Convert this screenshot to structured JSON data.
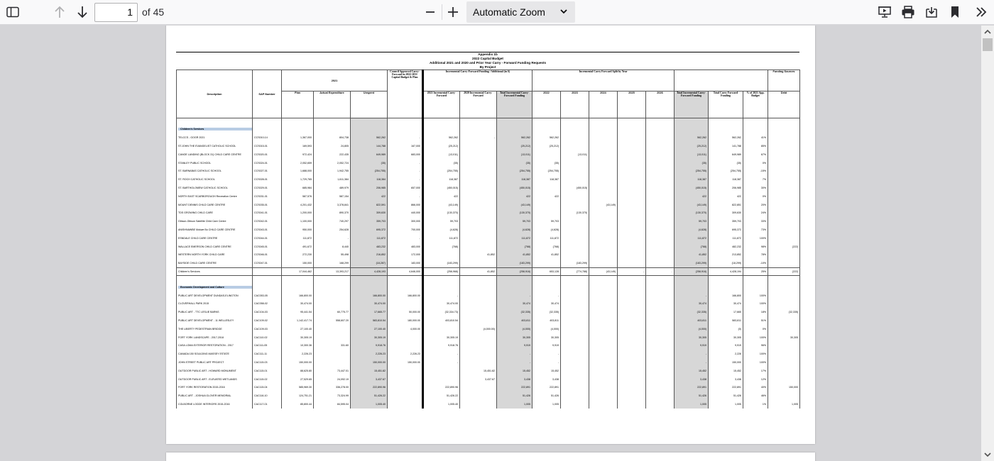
{
  "toolbar": {
    "page_number": "1",
    "page_of": "of 45",
    "zoom_value": "Automatic Zoom"
  },
  "document": {
    "title_lines": [
      "Appendix 1b",
      "2022 Capital Budget",
      "Additional 2021 and 2020 and Prior Year Carry - Forward Funding Requests",
      "By Project"
    ],
    "headers": {
      "description": "Description",
      "sap": "SAP Number",
      "year2021": "2021",
      "plan": "Plan",
      "actual": "Actual Expenditure",
      "unspent": "Unspent",
      "council": "Council Approved Carry-Forward in 2022-2031 Capital Budget & Plan",
      "incremental": "Incremental Carry-Forward Funding / Additional (in $)",
      "inc2021": "2021 Incremental Carry-Forward",
      "inc2020": "2020 Incremental Carry-Forward",
      "total_inc": "Total Incremental Carry-Forward Funding",
      "split": "Incremental Carry Forward Split by Year",
      "y2022": "2022",
      "y2023": "2023",
      "y2024": "2024",
      "y2025": "2025",
      "y2026": "2026",
      "total_inc2": "Total Incremental Carry-Forward Funding",
      "total_carry": "Total Carry Forward Funding",
      "pct": "% of 2021 App. Budget",
      "funding": "Funding Sources",
      "debt": "Debt"
    },
    "sections": [
      {
        "name": "Children's Services",
        "rows": [
          [
            "TELCCS - GOGR 2021",
            "CCS010-14",
            "1,367,000",
            "804,738",
            "562,262",
            "-",
            "562,262",
            "-",
            "562,262",
            "562,262",
            "",
            "",
            "",
            "",
            "562,262",
            "562,262",
            "41%",
            ""
          ],
          [
            "ST.JOHN THE EVANGELIST CATHOLIC SCHOOL",
            "CCS015-01",
            "169,593",
            "24,805",
            "144,788",
            "167,000",
            "(25,212)",
            "",
            "(25,212)",
            "(25,212)",
            "",
            "",
            "",
            "",
            "(25,212)",
            "141,788",
            "85%",
            ""
          ],
          [
            "CANOE LANDING (BLOCK 31) CHILD CARE CENTRE",
            "CCS020-01",
            "972,424",
            "222,435",
            "649,989",
            "683,000",
            "(13,011)",
            "",
            "(13,011)",
            "",
            "(13,011)",
            "",
            "",
            "",
            "(13,011)",
            "649,989",
            "67%",
            ""
          ],
          [
            "STANLEY PUBLIC SCHOOL",
            "CCS024-01",
            "2,052,659",
            "2,052,724",
            "(35)",
            "-",
            "(35)",
            "",
            "(35)",
            "(35)",
            "",
            "",
            "",
            "",
            "(35)",
            "(35)",
            "0%",
            ""
          ],
          [
            "ST. BARNABAS CATHOLIC SCHOOL",
            "CCS027-01",
            "1,688,000",
            "1,942,755",
            "(254,755)",
            "-",
            "(254,755)",
            "",
            "(254,755)",
            "(254,755)",
            "",
            "",
            "",
            "",
            "(254,755)",
            "(254,755)",
            "-15%",
            ""
          ],
          [
            "ST. ROCH CATHOLIC SCHOOL",
            "CCS028-01",
            "1,729,765",
            "1,611,384",
            "118,384",
            "-",
            "118,387",
            "",
            "118,387",
            "118,387",
            "",
            "",
            "",
            "",
            "118,387",
            "118,387",
            "7%",
            ""
          ],
          [
            "ST. BARTHOLOMEW CATHOLIC SCHOOL",
            "CCS029-01",
            "685,984",
            "489,979",
            "206,985",
            "657,000",
            "(450,015)",
            "",
            "(450,015)",
            "",
            "(450,015)",
            "",
            "",
            "",
            "(450,015)",
            "206,985",
            "30%",
            ""
          ],
          [
            "NORTH EAST SCARBOROUGH Recreation Centre",
            "CCS031-01",
            "587,576",
            "587,154",
            "422",
            "-",
            "422",
            "",
            "422",
            "422",
            "",
            "",
            "",
            "",
            "422",
            "422",
            "0%",
            ""
          ],
          [
            "MOUNT DENNIS CHILD CARE CENTRE",
            "CCS035-01",
            "4,201,432",
            "3,378,841",
            "822,591",
            "866,000",
            "(43,149)",
            "",
            "(43,149)",
            "",
            "",
            "(43,149)",
            "",
            "",
            "(43,149)",
            "822,851",
            "20%",
            ""
          ],
          [
            "TDS GROWING CHILD CARE",
            "CCS041-01",
            "1,200,000",
            "890,370",
            "309,630",
            "440,000",
            "(130,370)",
            "",
            "(130,370)",
            "",
            "(130,370)",
            "",
            "",
            "",
            "(130,370)",
            "309,630",
            "24%",
            ""
          ],
          [
            "Gibson-Gibson Satellite Child Care Centre",
            "CCS042-01",
            "1,100,000",
            "740,297",
            "359,703",
            "300,000",
            "59,703",
            "",
            "59,703",
            "59,703",
            "",
            "",
            "",
            "",
            "59,703",
            "359,703",
            "33%",
            ""
          ],
          [
            "ANISHNAWBE Mokwe Bo CHILD CARE CENTRE",
            "CCS043-01",
            "950,000",
            "254,628",
            "695,372",
            "700,000",
            "(4,628)",
            "",
            "(4,628)",
            "(4,628)",
            "",
            "",
            "",
            "",
            "(4,628)",
            "695,372",
            "73%",
            ""
          ],
          [
            "ESNDALE CHILD CARE CENTRE",
            "CCS044-01",
            "111,872",
            "-",
            "111,872",
            "-",
            "111,872",
            "",
            "111,872",
            "111,872",
            "",
            "",
            "",
            "",
            "111,872",
            "111,872",
            "100%",
            ""
          ],
          [
            "WALLACE EMERSON CHILD CARE CENTRE",
            "CCS045-01",
            "491,672",
            "8,440",
            "483,232",
            "483,000",
            "(768)",
            "",
            "(768)",
            "(768)",
            "",
            "",
            "",
            "",
            "(768)",
            "482,232",
            "98%",
            "(222)"
          ],
          [
            "WESTERN NORTH YORK CHILD CARE",
            "CCS046-01",
            "272,230",
            "55,498",
            "216,852",
            "172,000",
            "",
            "41,852",
            "41,852",
            "41,852",
            "",
            "",
            "",
            "",
            "41,852",
            "213,852",
            "78%",
            ""
          ],
          [
            "BAYSIDE CHILD CARE CENTRE",
            "CCS047-01",
            "150,000",
            "168,299",
            "(18,287)",
            "183,000",
            "(183,299)",
            "",
            "(183,299)",
            "",
            "(183,299)",
            "",
            "",
            "",
            "(183,299)",
            "(18,299)",
            "-10%",
            ""
          ]
        ],
        "total": [
          "Children's Services",
          "",
          "17,044,462",
          "13,393,217",
          "4,428,193",
          "4,646,000",
          "(258,968)",
          "41,852",
          "(258,916)",
          "653,128",
          "(774,788)",
          "(43,149)",
          "-",
          "-",
          "(258,916)",
          "4,428,194",
          "25%",
          "(222)"
        ]
      },
      {
        "name": "Economic Development and Culture",
        "rows": [
          [
            "PUBLIC ART DEVELOPMENT DUNDAS-ELINGTON",
            "CAC053-05",
            "166,800.00",
            "",
            "166,800.00",
            "166,800.00",
            "-",
            "",
            "-",
            "-",
            "",
            "",
            "",
            "",
            "-",
            "166,800",
            "100%",
            ""
          ],
          [
            "CLOVERHALL PARK 2015",
            "CAC058-02",
            "30,474.00",
            "",
            "30,474.00",
            "",
            "30,474.00",
            "",
            "30,474",
            "30,474",
            "",
            "",
            "",
            "",
            "30,474",
            "30,474",
            "100%",
            ""
          ],
          [
            "PUBLIC ART - TTC LESLIE BARNS",
            "CAC104-03",
            "95,441.54",
            "60,775.77",
            "17,665.77",
            "50,000.00",
            "(32,334.73)",
            "",
            "(32,335)",
            "(32,335)",
            "",
            "",
            "",
            "",
            "(32,335)",
            "17,665",
            "18%",
            "(32,335)"
          ],
          [
            "PUBLIC ART DEVELOPMENT - 11 WELLESLEY",
            "CAC109-02",
            "1,142,417.74",
            "558,607.20",
            "583,810.54",
            "180,000.00",
            "403,810.54",
            "",
            "403,811",
            "403,811",
            "",
            "",
            "",
            "",
            "403,811",
            "583,811",
            "51%",
            ""
          ],
          [
            "THE LIBERTY PEDESTRIAN BRIDGE",
            "CAC109-03",
            "27,100.40",
            "",
            "27,100.40",
            "4,000.00",
            "",
            "(4,000.00)",
            "(4,000)",
            "(4,000)",
            "",
            "",
            "",
            "",
            "(4,000)",
            "(0)",
            "0%",
            ""
          ],
          [
            "FORT YORK LANDSCAPE - 2017-2018",
            "CAC110-02",
            "30,305.19",
            "",
            "30,305.19",
            "",
            "30,305.19",
            "",
            "30,305",
            "30,305",
            "",
            "",
            "",
            "",
            "30,305",
            "30,305",
            "100%",
            "30,305"
          ],
          [
            "CASA LOMA EXTERIOR RESTORATION - 2017",
            "CAC111-05",
            "10,300.36",
            "331.60",
            "9,918.76",
            "",
            "9,918.76",
            "",
            "9,919",
            "9,919",
            "",
            "",
            "",
            "",
            "9,919",
            "9,919",
            "96%",
            ""
          ],
          [
            "CANADA 150 SOULDING MASSEY ESTATE",
            "CAC111-11",
            "2,226.23",
            "",
            "2,226.23",
            "2,226.23",
            "-",
            "",
            "-",
            "-",
            "",
            "",
            "",
            "",
            "-",
            "2,226",
            "100%",
            ""
          ],
          [
            "JOHN STREET PUBLIC ART PROJECT",
            "CAC115-03",
            "150,000.00",
            "",
            "150,000.00",
            "150,000.00",
            "-",
            "",
            "-",
            "-",
            "",
            "",
            "",
            "",
            "-",
            "150,000",
            "100%",
            ""
          ],
          [
            "OUTDOOR PUBLIC ART - HOWARD MONUMENT",
            "CAC115-01",
            "88,625.80",
            "73,447.01",
            "15,451.82",
            "",
            "",
            "15,451.82",
            "15,452",
            "15,452",
            "",
            "",
            "",
            "",
            "15,452",
            "15,452",
            "17%",
            ""
          ],
          [
            "OUTDOOR PUBLIC ART - ELEVATED WETLANDS",
            "CAC115-02",
            "27,529.65",
            "24,092.19",
            "3,437.67",
            "",
            "",
            "3,437.67",
            "3,438",
            "3,438",
            "",
            "",
            "",
            "",
            "3,438",
            "3,438",
            "12%",
            ""
          ],
          [
            "FORT YORK RESTORATION 2015-2016",
            "CAC115-04",
            "585,969.30",
            "336,278.00",
            "222,890.96",
            "",
            "222,890.96",
            "",
            "222,891",
            "222,891",
            "",
            "",
            "",
            "",
            "222,891",
            "222,891",
            "40%",
            "150,000"
          ],
          [
            "PUBLIC ART - JOSHUA GLOVER MEMORIAL",
            "CAC116-10",
            "124,751.21",
            "73,324.99",
            "51,426.22",
            "",
            "51,426.22",
            "",
            "51,426",
            "51,426",
            "",
            "",
            "",
            "",
            "51,426",
            "51,426",
            "46%",
            ""
          ],
          [
            "COLBORNE LODGE INTERIORS 2015-2016",
            "CAC117-01",
            "85,800.44",
            "84,595.04",
            "1,005.40",
            "",
            "1,005.40",
            "",
            "1,005",
            "1,005",
            "",
            "",
            "",
            "",
            "1,005",
            "1,005",
            "1%",
            "1,005"
          ]
        ]
      }
    ]
  }
}
